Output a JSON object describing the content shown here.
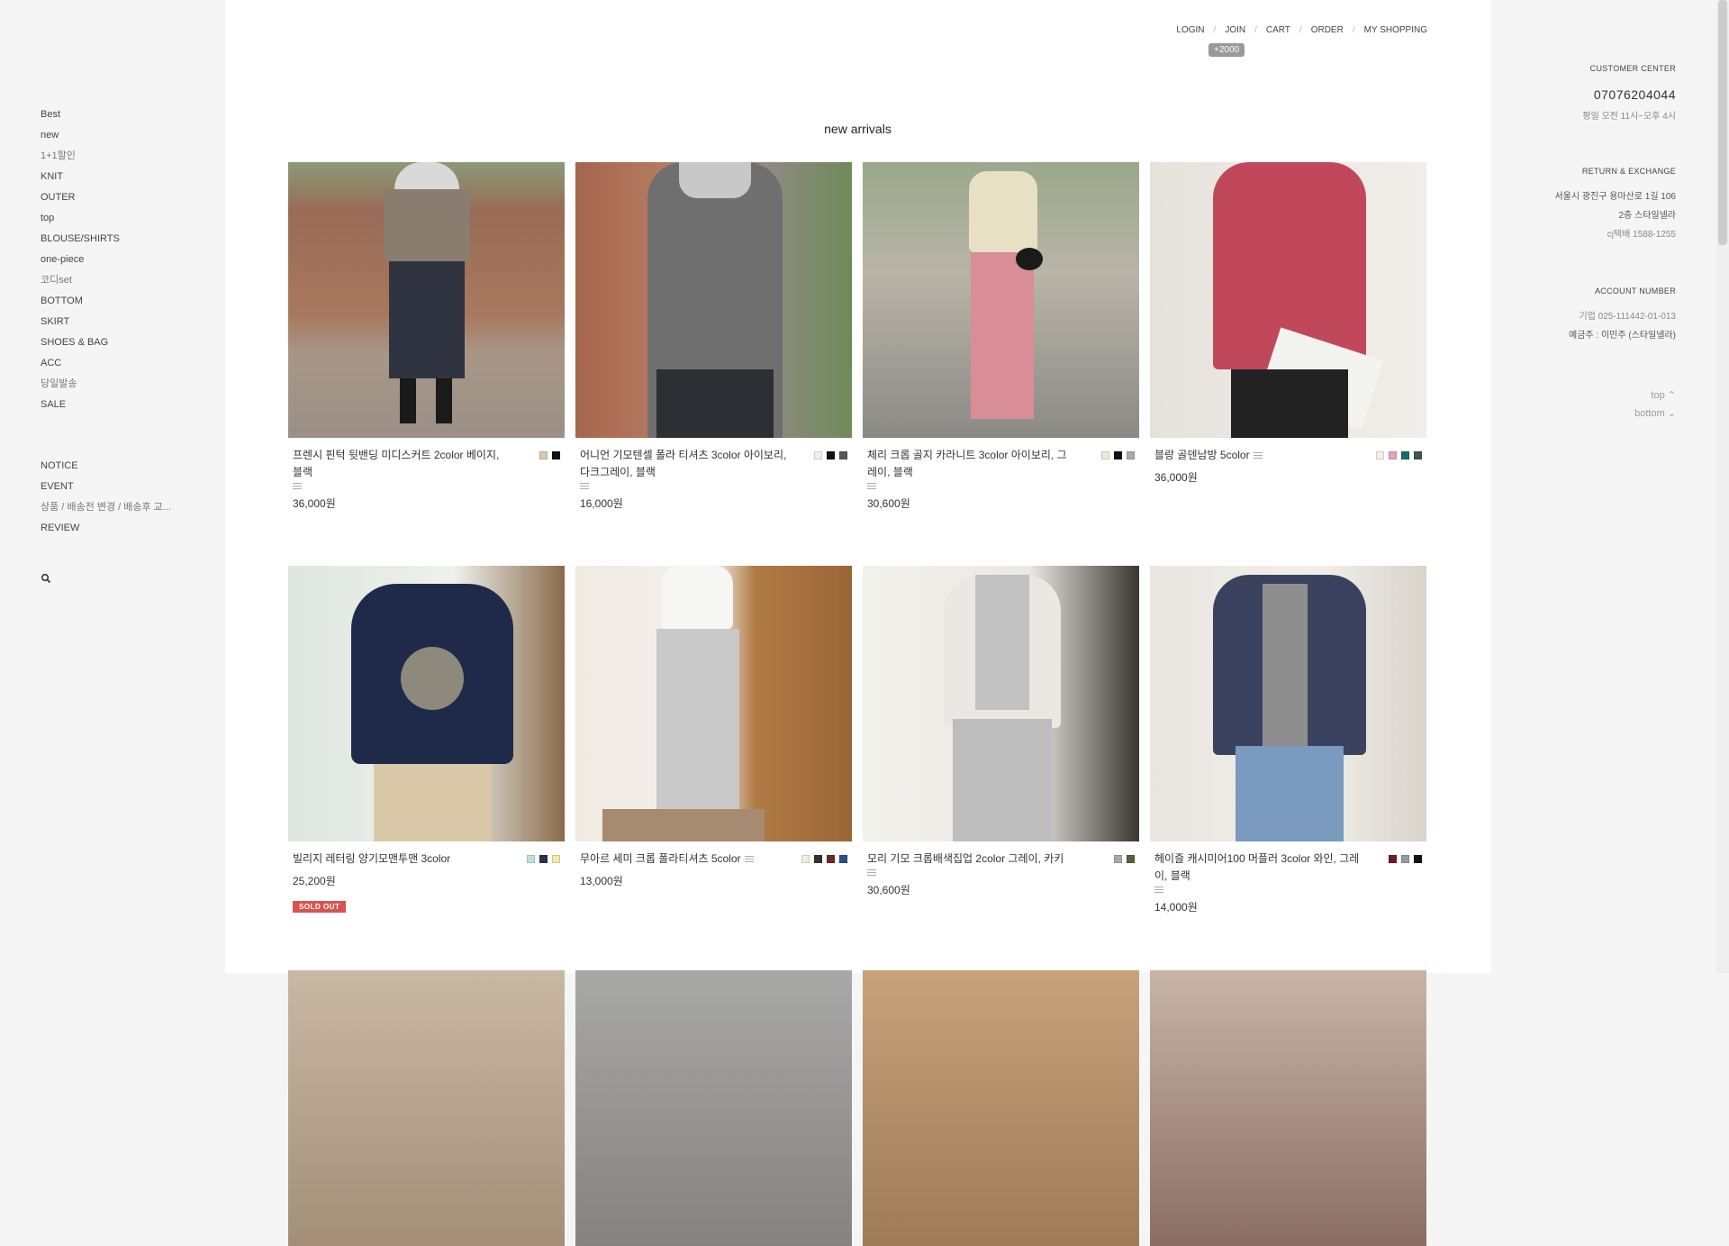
{
  "sidebar": {
    "categories": [
      "Best",
      "new",
      "1+1할인",
      "KNIT",
      "OUTER",
      "top",
      "BLOUSE/SHIRTS",
      "one-piece",
      "코디set",
      "BOTTOM",
      "SKIRT",
      "SHOES & BAG",
      "ACC",
      "당일발송",
      "SALE"
    ],
    "board": [
      "NOTICE",
      "EVENT",
      "상품 / 배송전 변경 / 배송후 교...",
      "REVIEW"
    ]
  },
  "topnav": {
    "login": "LOGIN",
    "join": "JOIN",
    "cart": "CART",
    "order": "ORDER",
    "my_shopping": "MY SHOPPING",
    "join_badge": "+2000"
  },
  "section_title": "new arrivals",
  "products": [
    {
      "name": "프렌시 핀턱 뒷밴딩 미디스커트 2color 베이지,블랙",
      "price": "36,000원",
      "colors": [
        "#d8c8b0",
        "#111111"
      ],
      "sold_out": false
    },
    {
      "name": "어니언 기모텐셀 폴라 티셔츠 3color 아이보리, 다크그레이, 블랙",
      "price": "16,000원",
      "colors": [
        "#f2efe6",
        "#111111",
        "#555555"
      ],
      "sold_out": false
    },
    {
      "name": "체리 크롭 골지 카라니트 3color 아이보리, 그레이, 블랙",
      "price": "30,600원",
      "colors": [
        "#efe9d8",
        "#111111",
        "#aaaaaa"
      ],
      "sold_out": false
    },
    {
      "name": "블랑 골덴남방 5color",
      "price": "36,000원",
      "colors": [
        "#f4f1e3",
        "#e8a0b8",
        "#1a6b6b",
        "#3c5a46"
      ],
      "sold_out": false
    },
    {
      "name": "빌리지 레터링 양기모맨투맨 3color",
      "price": "25,200원",
      "colors": [
        "#bfe0de",
        "#2b3250",
        "#f3e9a8"
      ],
      "sold_out": true,
      "sold_out_label": "SOLD OUT"
    },
    {
      "name": "무아르 세미 크롭 폴라티셔츠 5color",
      "price": "13,000원",
      "colors": [
        "#f1ecdc",
        "#333333",
        "#6b2a2a",
        "#2d4d8c"
      ],
      "sold_out": false
    },
    {
      "name": "모리 기모 크롭배색집업 2color 그레이, 카키",
      "price": "30,600원",
      "colors": [
        "#aaaaaa",
        "#5a5e3c"
      ],
      "sold_out": false
    },
    {
      "name": "헤이즐 캐시미어100 머플러 3color 와인, 그레이, 블랙",
      "price": "14,000원",
      "colors": [
        "#6e1a25",
        "#999999",
        "#111111"
      ],
      "sold_out": false
    }
  ],
  "right": {
    "cs_title": "CUSTOMER CENTER",
    "phone": "07076204044",
    "hours": "평일 오전 11시~오후 4시",
    "return_title": "RETURN & EXCHANGE",
    "addr1": "서울시 광진구 용마산로 1길 106",
    "addr2": "2층 스타일넬라",
    "courier": "cj택배 1588-1255",
    "account_title": "ACCOUNT NUMBER",
    "account": "기업 025-111442-01-013",
    "holder": "예금주 : 이민주 (스타일넬라)",
    "top_link": "top",
    "bottom_link": "bottom"
  }
}
